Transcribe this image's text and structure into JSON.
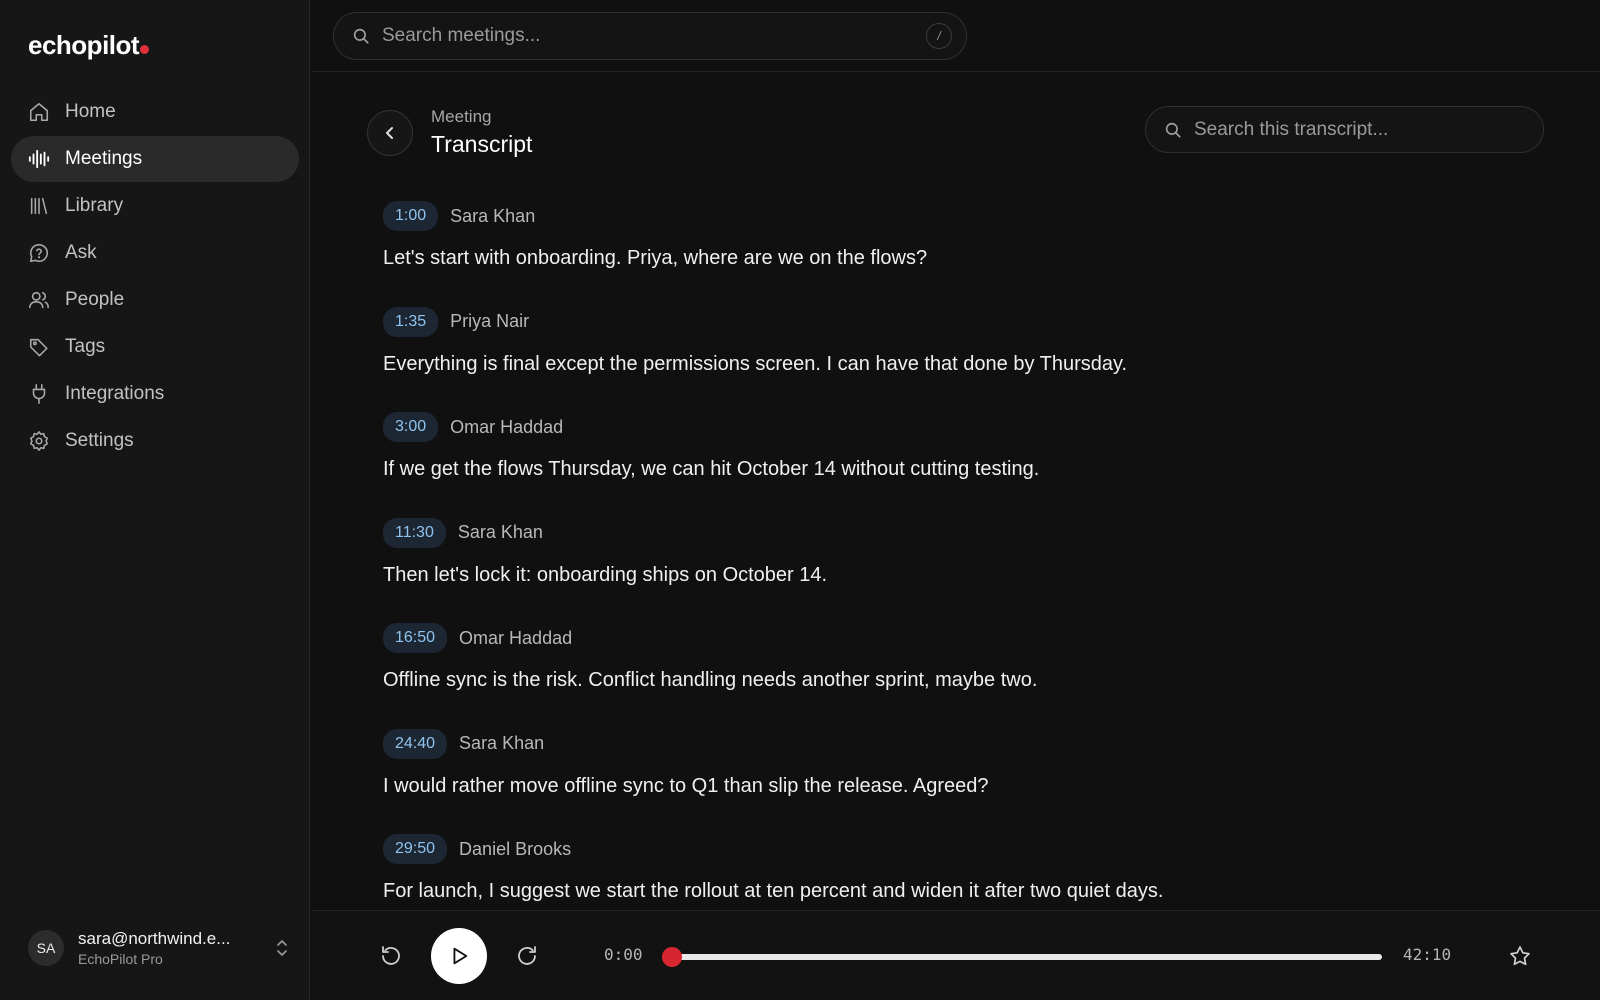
{
  "app": {
    "brand": "echopilot",
    "accent": "#e0323c"
  },
  "search": {
    "placeholder": "Search meetings...",
    "shortcut": "/"
  },
  "nav": [
    {
      "label": "Home",
      "icon": "home-icon",
      "active": false
    },
    {
      "label": "Meetings",
      "icon": "waveform-icon",
      "active": true
    },
    {
      "label": "Library",
      "icon": "library-icon",
      "active": false
    },
    {
      "label": "Ask",
      "icon": "question-bubble-icon",
      "active": false
    },
    {
      "label": "People",
      "icon": "people-icon",
      "active": false
    },
    {
      "label": "Tags",
      "icon": "tag-icon",
      "active": false
    },
    {
      "label": "Integrations",
      "icon": "plug-icon",
      "active": false
    },
    {
      "label": "Settings",
      "icon": "gear-icon",
      "active": false
    }
  ],
  "account": {
    "initials": "SA",
    "email": "sara@northwind.e...",
    "plan": "EchoPilot Pro"
  },
  "header": {
    "breadcrumb": "Meeting",
    "title": "Transcript",
    "search_placeholder": "Search this transcript..."
  },
  "transcript": [
    {
      "time": "1:00",
      "speaker": "Sara Khan",
      "text": "Let's start with onboarding. Priya, where are we on the flows?"
    },
    {
      "time": "1:35",
      "speaker": "Priya Nair",
      "text": "Everything is final except the permissions screen. I can have that done by Thursday."
    },
    {
      "time": "3:00",
      "speaker": "Omar Haddad",
      "text": "If we get the flows Thursday, we can hit October 14 without cutting testing."
    },
    {
      "time": "11:30",
      "speaker": "Sara Khan",
      "text": "Then let's lock it: onboarding ships on October 14."
    },
    {
      "time": "16:50",
      "speaker": "Omar Haddad",
      "text": "Offline sync is the risk. Conflict handling needs another sprint, maybe two."
    },
    {
      "time": "24:40",
      "speaker": "Sara Khan",
      "text": "I would rather move offline sync to Q1 than slip the release. Agreed?"
    },
    {
      "time": "29:50",
      "speaker": "Daniel Brooks",
      "text": "For launch, I suggest we start the rollout at ten percent and widen it after two quiet days."
    }
  ],
  "player": {
    "current": "0:00",
    "total": "42:10",
    "progress": 0
  }
}
